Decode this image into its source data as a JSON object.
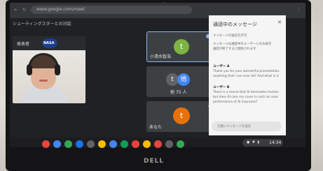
{
  "browser": {
    "url": "www.google.com/meet",
    "right_hint": "⋮"
  },
  "meeting": {
    "title": "シューティングスターとの対話",
    "speaker_label": "発表者",
    "nasa_logo": "NASA"
  },
  "tiles": [
    {
      "name": "小清水智浩",
      "avatar": "t",
      "color": "#7cb342"
    },
    {
      "name": "他 75 人",
      "avatar_left": "t",
      "avatar_right": "他",
      "color": "#4285f4"
    },
    {
      "name": "あなた",
      "avatar": "t",
      "color": "#e8710a"
    }
  ],
  "chat": {
    "title": "通話中のメッセージ",
    "notice1": "メッセージの送信を許可",
    "notice2": "メッセージは通話中のユーザーにのみ表示",
    "notice3": "通話が終了すると削除されます",
    "sender1": "ユーザー A",
    "msg1a": "Thank you for your wonderful presentation.",
    "msg1b": "anything that I can ever do? And what is it",
    "sender2": "ユーザー B",
    "msg2a": "There is a movie that Al dominates human",
    "msg2b": "but does AI care my cover in such an area",
    "msg2c": "performance of AI improves?",
    "input_placeholder": "全員にメッセージを送信"
  },
  "shelf": {
    "clock": "14:34",
    "tray": "● ▼ ▮"
  },
  "brand": "DELL",
  "colors": {
    "chat_bg": "#f5f5f5",
    "tile_bg": "#3c4043",
    "accent": "#8ab4f8"
  }
}
